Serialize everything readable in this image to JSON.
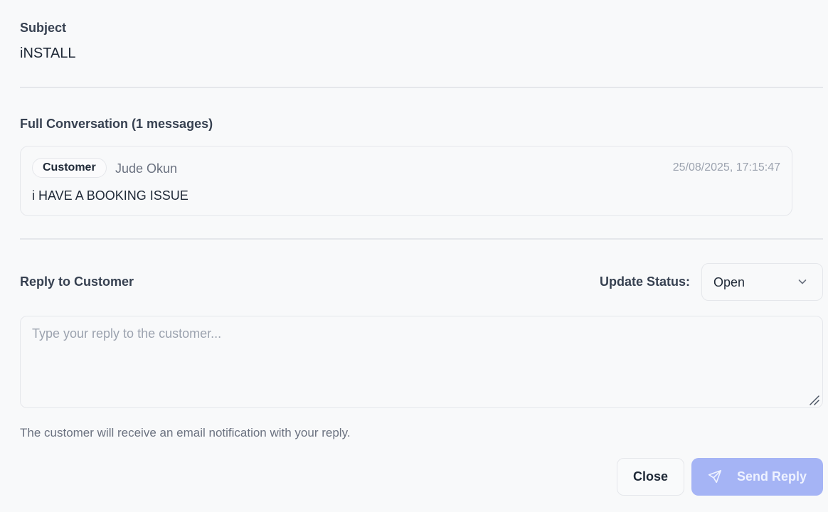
{
  "subject": {
    "label": "Subject",
    "value": "iNSTALL"
  },
  "conversation": {
    "heading": "Full Conversation (1 messages)",
    "messages": [
      {
        "role": "Customer",
        "sender": "Jude Okun",
        "timestamp": "25/08/2025, 17:15:47",
        "body": "i HAVE A BOOKING ISSUE"
      }
    ]
  },
  "reply": {
    "heading": "Reply to Customer",
    "placeholder": "Type your reply to the customer...",
    "hint": "The customer will receive an email notification with your reply."
  },
  "status": {
    "label": "Update Status:",
    "selected": "Open"
  },
  "actions": {
    "close_label": "Close",
    "send_label": "Send Reply"
  },
  "icons": {
    "status_chevron": "chevron-down-icon",
    "send": "send-icon",
    "resize": "resize-handle-icon"
  },
  "colors": {
    "send_button_bg": "#a5b4f5",
    "send_button_text": "#eef2ff"
  }
}
